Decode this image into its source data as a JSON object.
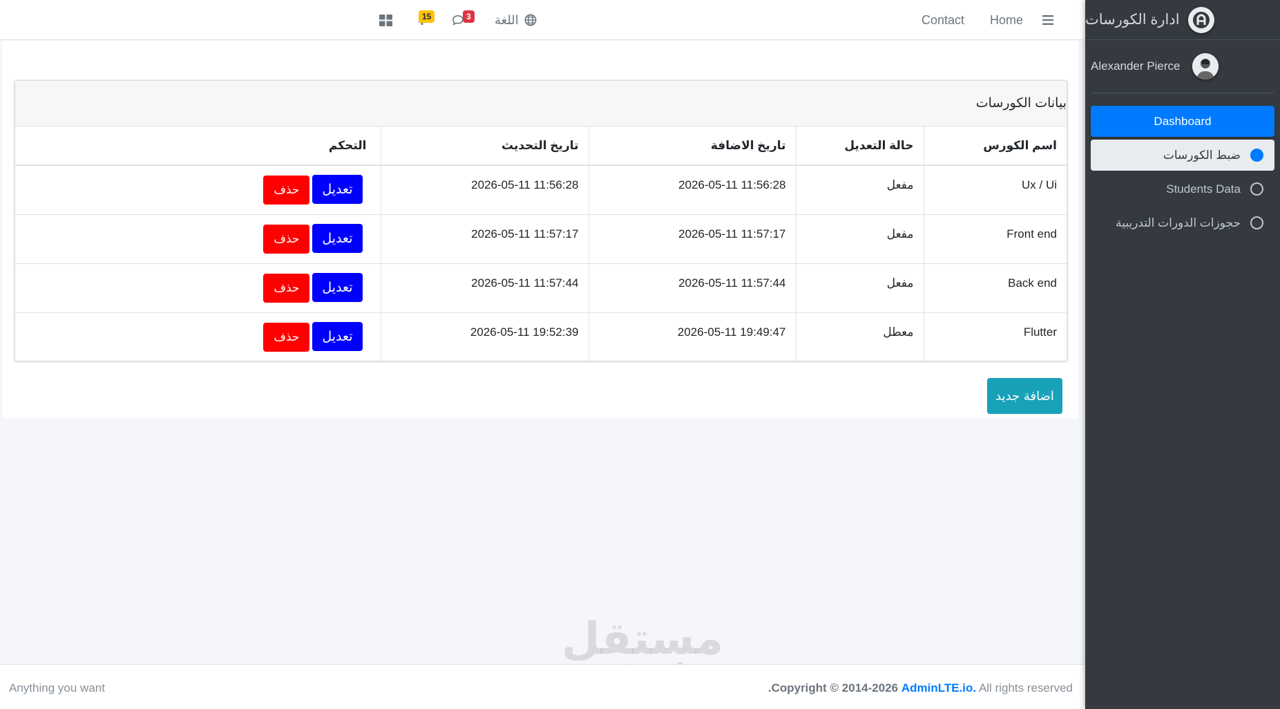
{
  "sidebar": {
    "brand_title": "ادارة الكورسات",
    "brand_logo_letter": "A",
    "user_name": "Alexander Pierce",
    "items": [
      {
        "label": "Dashboard",
        "style": "primary"
      },
      {
        "label": "ضبط الكورسات",
        "style": "active"
      },
      {
        "label": "Students Data",
        "style": "normal"
      },
      {
        "label": "حجوزات الدورات التدريبية",
        "style": "normal"
      }
    ]
  },
  "navbar": {
    "menu_icon": "hamburger-icon",
    "home_label": "Home",
    "contact_label": "Contact",
    "language_label": "اللغة",
    "messages_count": "3",
    "notifications_count": "15",
    "apps_icon": "grid-icon"
  },
  "card": {
    "title": "بيانات الكورسات",
    "columns": [
      "اسم الكورس",
      "حالة التعديل",
      "تاريخ الاضافة",
      "تاريخ التحديث",
      "التحكم"
    ],
    "rows": [
      {
        "name": "Ux / Ui",
        "status": "مفعل",
        "added": "2026-05-11 11:56:28",
        "updated": "2026-05-11 11:56:28"
      },
      {
        "name": "Front end",
        "status": "مفعل",
        "added": "2026-05-11 11:57:17",
        "updated": "2026-05-11 11:57:17"
      },
      {
        "name": "Back end",
        "status": "مفعل",
        "added": "2026-05-11 11:57:44",
        "updated": "2026-05-11 11:57:44"
      },
      {
        "name": "Flutter",
        "status": "معطل",
        "added": "2026-05-11 19:49:47",
        "updated": "2026-05-11 19:52:39"
      }
    ],
    "edit_label": "تعديل",
    "delete_label": "حذف"
  },
  "add_button_label": "اضافة جديد",
  "footer": {
    "left_text": "Anything you want",
    "copyright_prefix": "Copyright © 2014-2026",
    "copyright_brand": "AdminLTE.io.",
    "copyright_suffix": "All rights reserved",
    "copyright_lead": "."
  },
  "watermark": {
    "arabic": "مستقل",
    "latin": "mostaql.com"
  },
  "colors": {
    "sidebar_bg": "#343a40",
    "primary": "#007bff",
    "edit_button": "#0000ff",
    "delete_button": "#ff0000",
    "add_button": "#17a2b8",
    "messages_badge": "#dc3545",
    "notifications_badge": "#ffc107"
  }
}
